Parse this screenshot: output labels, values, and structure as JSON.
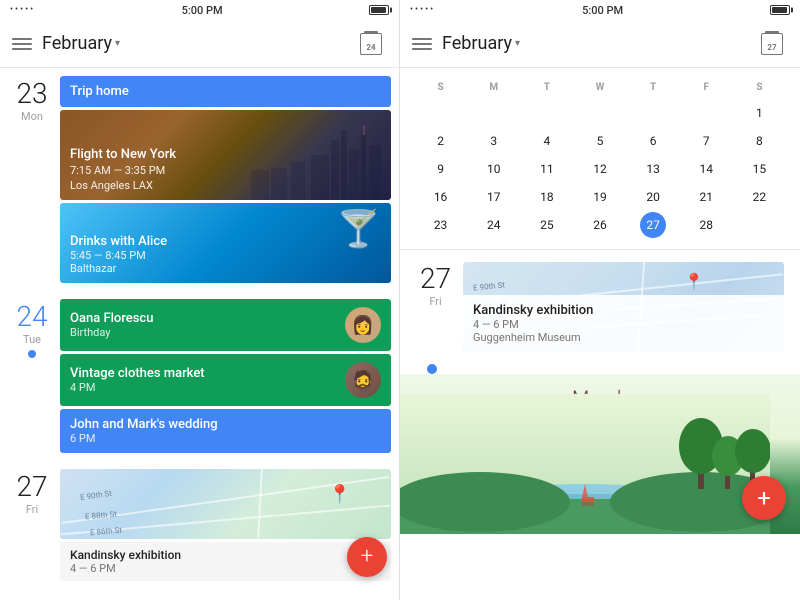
{
  "left_panel": {
    "status": {
      "dots": "•••••",
      "time": "5:00 PM",
      "battery_pct": 70
    },
    "header": {
      "menu_label": "menu",
      "title": "February",
      "cal_icon_date": "24"
    },
    "days": [
      {
        "number": "23",
        "name": "Mon",
        "is_today": false,
        "events": [
          {
            "type": "label",
            "color": "blue",
            "text": "Trip home"
          },
          {
            "type": "image",
            "title": "Flight to New York",
            "sub1": "7:15 AM — 3:35 PM",
            "sub2": "Los Angeles LAX"
          },
          {
            "type": "drinks",
            "title": "Drinks with Alice",
            "sub1": "5:45 — 8:45 PM",
            "sub2": "Balthazar"
          }
        ]
      },
      {
        "number": "24",
        "name": "Tue",
        "is_today": false,
        "events": [
          {
            "type": "avatar",
            "color": "green",
            "title": "Oana Florescu",
            "sub": "Birthday"
          },
          {
            "type": "label",
            "color": "green",
            "title": "Vintage clothes market",
            "sub": "4 PM"
          },
          {
            "type": "label",
            "color": "blue",
            "title": "John and Mark's wedding",
            "sub": "6 PM"
          }
        ]
      },
      {
        "number": "27",
        "name": "Fri",
        "is_today": false,
        "events": [
          {
            "type": "map",
            "title": "Kandinsky exhibition",
            "sub": "4 — 6 PM"
          }
        ]
      }
    ]
  },
  "right_panel": {
    "status": {
      "dots": "•••••",
      "time": "5:00 PM"
    },
    "header": {
      "title": "February",
      "cal_icon_date": "27"
    },
    "mini_calendar": {
      "dow": [
        "S",
        "M",
        "T",
        "W",
        "T",
        "F",
        "S"
      ],
      "weeks": [
        [
          {
            "d": "",
            "cls": ""
          },
          {
            "d": "",
            "cls": ""
          },
          {
            "d": "",
            "cls": ""
          },
          {
            "d": "",
            "cls": ""
          },
          {
            "d": "",
            "cls": ""
          },
          {
            "d": "",
            "cls": ""
          },
          {
            "d": "1",
            "cls": ""
          }
        ],
        [
          {
            "d": "2",
            "cls": ""
          },
          {
            "d": "3",
            "cls": ""
          },
          {
            "d": "4",
            "cls": ""
          },
          {
            "d": "5",
            "cls": ""
          },
          {
            "d": "6",
            "cls": ""
          },
          {
            "d": "7",
            "cls": ""
          },
          {
            "d": "8",
            "cls": ""
          }
        ],
        [
          {
            "d": "9",
            "cls": ""
          },
          {
            "d": "10",
            "cls": ""
          },
          {
            "d": "11",
            "cls": ""
          },
          {
            "d": "12",
            "cls": ""
          },
          {
            "d": "13",
            "cls": ""
          },
          {
            "d": "14",
            "cls": ""
          },
          {
            "d": "15",
            "cls": ""
          }
        ],
        [
          {
            "d": "16",
            "cls": ""
          },
          {
            "d": "17",
            "cls": ""
          },
          {
            "d": "18",
            "cls": ""
          },
          {
            "d": "19",
            "cls": ""
          },
          {
            "d": "20",
            "cls": ""
          },
          {
            "d": "21",
            "cls": ""
          },
          {
            "d": "22",
            "cls": ""
          }
        ],
        [
          {
            "d": "23",
            "cls": ""
          },
          {
            "d": "24",
            "cls": ""
          },
          {
            "d": "25",
            "cls": ""
          },
          {
            "d": "26",
            "cls": ""
          },
          {
            "d": "27",
            "cls": "today-highlight"
          },
          {
            "d": "28",
            "cls": ""
          }
        ]
      ]
    },
    "detail": {
      "day_number": "27",
      "day_name": "Fri",
      "event": {
        "title": "Kandinsky exhibition",
        "sub1": "4 — 6 PM",
        "sub2": "Guggenheim Museum"
      }
    },
    "march": {
      "title": "March"
    }
  },
  "icons": {
    "hamburger": "☰",
    "dropdown": "▾",
    "fab_plus": "+"
  },
  "colors": {
    "blue": "#4285f4",
    "green": "#0f9d58",
    "red": "#ea4335",
    "text_primary": "#212121",
    "text_secondary": "#9e9e9e"
  }
}
